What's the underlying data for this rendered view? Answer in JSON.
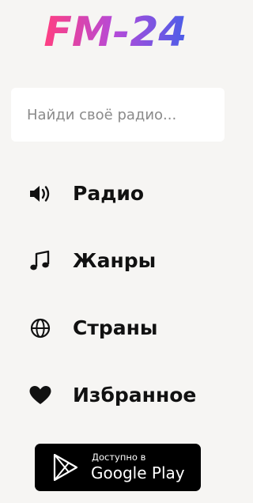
{
  "logo": {
    "text": "FM-24",
    "gradient_start": "#ff3f81",
    "gradient_mid": "#b44ad9",
    "gradient_end": "#4a5ee8"
  },
  "search": {
    "placeholder": "Найди своё радио...",
    "value": ""
  },
  "nav": {
    "items": [
      {
        "label": "Радио",
        "icon": "speaker-icon"
      },
      {
        "label": "Жанры",
        "icon": "music-note-icon"
      },
      {
        "label": "Страны",
        "icon": "globe-icon"
      },
      {
        "label": "Избранное",
        "icon": "heart-icon"
      }
    ]
  },
  "store_badge": {
    "small_text": "Доступно в",
    "big_text": "Google Play"
  },
  "colors": {
    "background": "#f6f5f3",
    "text": "#111111",
    "badge_background": "#000000"
  }
}
